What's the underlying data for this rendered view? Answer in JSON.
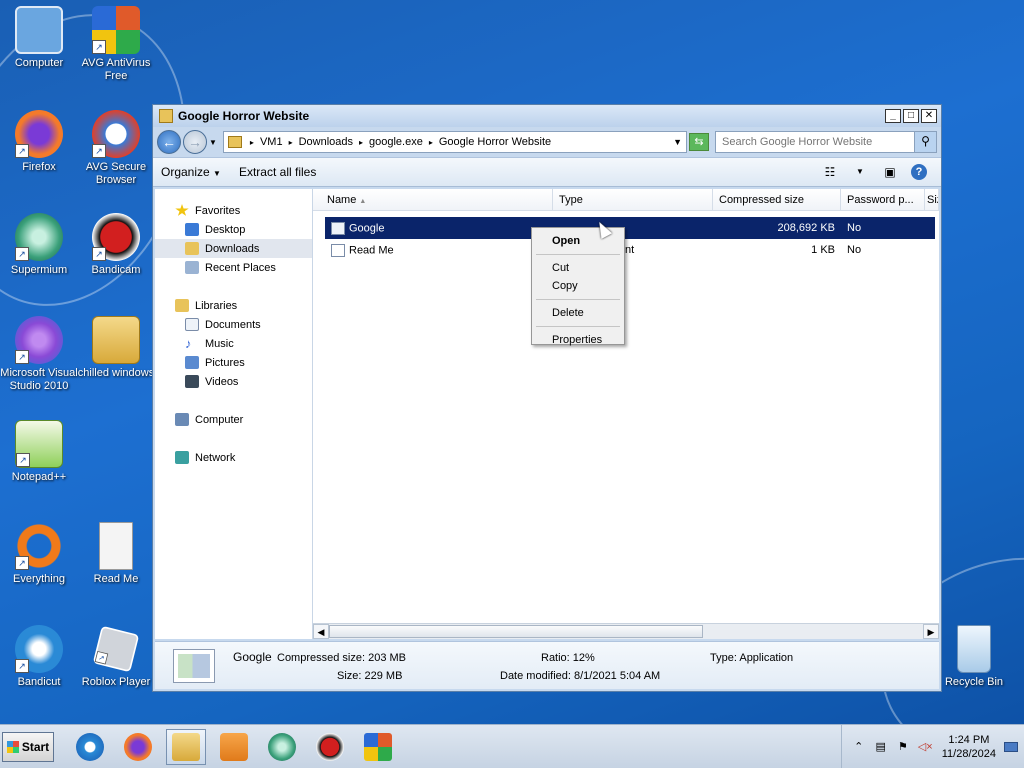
{
  "desktop_icons": [
    {
      "label": "Computer",
      "icon": "computer-icon",
      "color": "#6aa6e0"
    },
    {
      "label": "AVG AntiVirus Free",
      "icon": "avg-icon",
      "color": "#e05a2a"
    },
    {
      "label": "Firefox",
      "icon": "firefox-icon",
      "color": "#f47a2a"
    },
    {
      "label": "AVG Secure Browser",
      "icon": "avg-browser-icon",
      "color": "#3a7ad6"
    },
    {
      "label": "Supermium",
      "icon": "supermium-icon",
      "color": "#3aa07a"
    },
    {
      "label": "Bandicam",
      "icon": "bandicam-icon",
      "color": "#d21f1f"
    },
    {
      "label": "Microsoft Visual Studio 2010",
      "icon": "visual-studio-icon",
      "color": "#8a4ad6"
    },
    {
      "label": "chilled windows",
      "icon": "folder-icon",
      "color": "#e8c35a"
    },
    {
      "label": "Notepad++",
      "icon": "notepadpp-icon",
      "color": "#8fd05a"
    },
    {
      "label": "Everything",
      "icon": "everything-icon",
      "color": "#f07a1a"
    },
    {
      "label": "Read Me",
      "icon": "document-icon",
      "color": "#f4f4f4"
    },
    {
      "label": "Bandicut",
      "icon": "bandicut-icon",
      "color": "#2a8ad6"
    },
    {
      "label": "Roblox Player",
      "icon": "roblox-icon",
      "color": "#d0d4da"
    },
    {
      "label": "Recycle Bin",
      "icon": "recycle-bin-icon",
      "color": "#cfe3f5"
    }
  ],
  "window": {
    "title": "Google Horror Website",
    "minimize": "_",
    "maximize": "□",
    "close": "✕"
  },
  "address": {
    "crumbs": [
      "VM1",
      "Downloads",
      "google.exe",
      "Google Horror Website"
    ],
    "search_placeholder": "Search Google Horror Website"
  },
  "commandbar": {
    "organize": "Organize",
    "extract": "Extract all files"
  },
  "navpane": {
    "favorites": "Favorites",
    "desktop": "Desktop",
    "downloads": "Downloads",
    "recent": "Recent Places",
    "libraries": "Libraries",
    "documents": "Documents",
    "music": "Music",
    "pictures": "Pictures",
    "videos": "Videos",
    "computer": "Computer",
    "network": "Network"
  },
  "columns": [
    "Name",
    "Type",
    "Compressed size",
    "Password p...",
    "Siz"
  ],
  "files": [
    {
      "name": "Google",
      "type": "",
      "compressed": "208,692 KB",
      "password": "No"
    },
    {
      "name": "Read Me",
      "type": "nt",
      "compressed": "1 KB",
      "password": "No"
    }
  ],
  "context_menu": {
    "open": "Open",
    "cut": "Cut",
    "copy": "Copy",
    "delete": "Delete",
    "properties": "Properties"
  },
  "details": {
    "name": "Google",
    "compressed_size": "Compressed size: 203 MB",
    "size": "Size: 229 MB",
    "ratio": "Ratio: 12%",
    "date_modified": "Date modified: 8/1/2021 5:04 AM",
    "type": "Type: Application"
  },
  "taskbar": {
    "start": "Start",
    "time": "1:24 PM",
    "date": "11/28/2024"
  }
}
